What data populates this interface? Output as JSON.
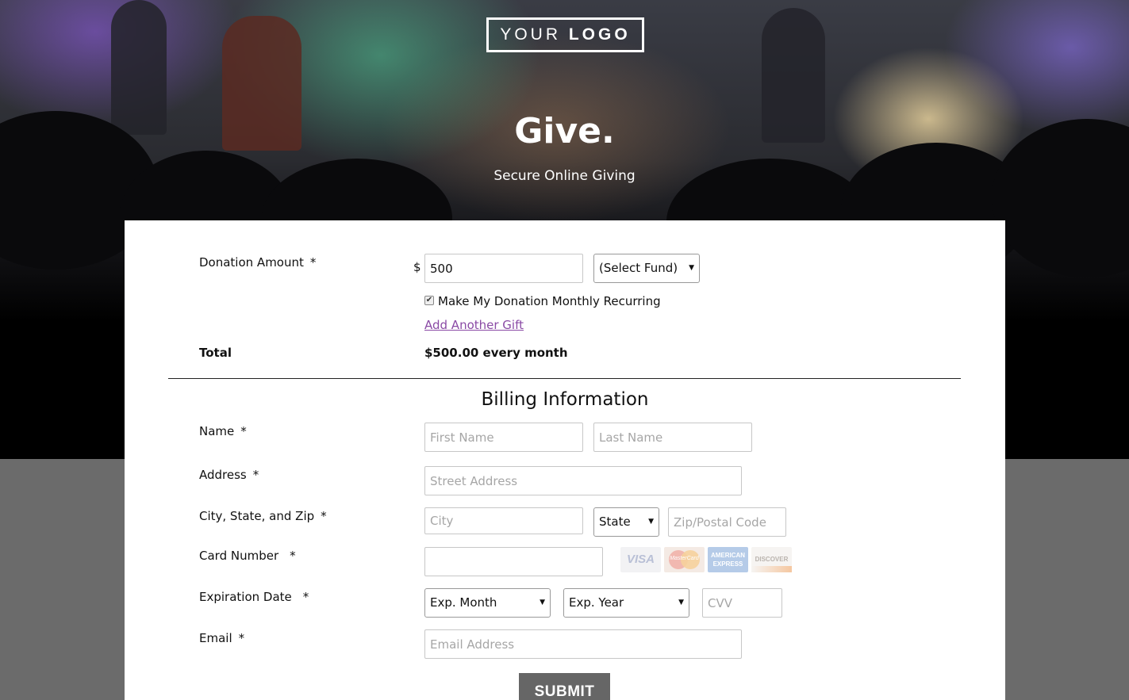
{
  "logo": {
    "word1": "YOUR",
    "word2": "LOGO"
  },
  "hero": {
    "title": "Give.",
    "subtitle": "Secure Online Giving"
  },
  "donation": {
    "label": "Donation Amount",
    "required": "*",
    "currency": "$",
    "amount": "500",
    "fund_select": "(Select Fund)",
    "recurring_label": "Make My Donation Monthly Recurring",
    "recurring_checked": true,
    "add_gift": "Add Another Gift",
    "total_label": "Total",
    "total_value": "$500.00 every month"
  },
  "billing": {
    "heading": "Billing Information",
    "name": {
      "label": "Name",
      "required": "*",
      "first_placeholder": "First Name",
      "last_placeholder": "Last Name"
    },
    "address": {
      "label": "Address",
      "required": "*",
      "placeholder": "Street Address"
    },
    "city_state_zip": {
      "label": "City, State, and Zip",
      "required": "*",
      "city_placeholder": "City",
      "state_select": "State",
      "zip_placeholder": "Zip/Postal Code"
    },
    "card": {
      "label": "Card Number",
      "required": "*",
      "value": "",
      "logos": [
        "VISA",
        "MasterCard",
        "AMERICAN EXPRESS",
        "DISCOVER"
      ]
    },
    "expiration": {
      "label": "Expiration Date",
      "required": "*",
      "month_select": "Exp. Month",
      "year_select": "Exp. Year",
      "cvv_placeholder": "CVV"
    },
    "email": {
      "label": "Email",
      "required": "*",
      "placeholder": "Email Address"
    }
  },
  "submit_label": "SUBMIT",
  "colors": {
    "link": "#8a4aa5",
    "submit_bg": "#666666",
    "page_bg": "#6b6b6b"
  }
}
